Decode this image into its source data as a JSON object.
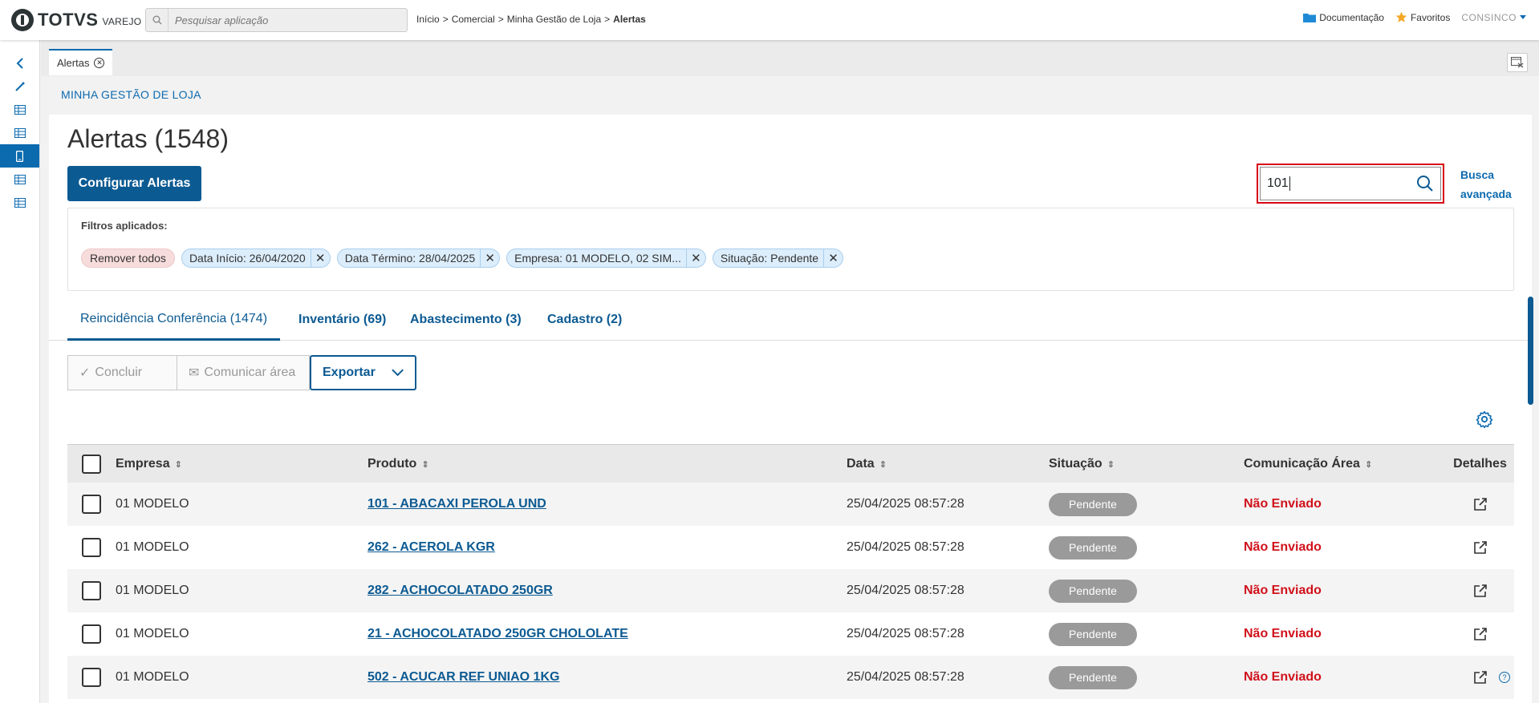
{
  "app": {
    "logo_text": "TOTVS",
    "logo_sub": "VAREJO",
    "search_placeholder": "Pesquisar aplicação",
    "breadcrumb": [
      "Início",
      "Comercial",
      "Minha Gestão de Loja",
      "Alertas"
    ],
    "breadcrumb_sep": ">",
    "documentation": "Documentação",
    "favorites": "Favoritos",
    "user": "CONSINCO"
  },
  "tab": {
    "label": "Alertas"
  },
  "section": {
    "title": "MINHA GESTÃO DE LOJA"
  },
  "page": {
    "title": "Alertas (1548)",
    "configure_button": "Configurar Alertas",
    "search_value": "101",
    "advanced_search_line1": "Busca",
    "advanced_search_line2": "avançada"
  },
  "filters": {
    "label": "Filtros aplicados:",
    "remove_all": "Remover todos",
    "chips": [
      "Data Início: 26/04/2020",
      "Data Término: 28/04/2025",
      "Empresa: 01 MODELO, 02 SIM...",
      "Situação: Pendente"
    ]
  },
  "detail_tabs": [
    "Reincidência Conferência (1474)",
    "Inventário (69)",
    "Abastecimento (3)",
    "Cadastro (2)"
  ],
  "actions": {
    "conclude": "Concluir",
    "communicate": "Comunicar área",
    "export": "Exportar"
  },
  "table": {
    "columns": [
      "Empresa",
      "Produto",
      "Data",
      "Situação",
      "Comunicação Área",
      "Detalhes"
    ],
    "rows": [
      {
        "empresa": "01 MODELO",
        "produto": "101 - ABACAXI PEROLA UND",
        "data": "25/04/2025 08:57:28",
        "situacao": "Pendente",
        "comunicacao": "Não Enviado"
      },
      {
        "empresa": "01 MODELO",
        "produto": "262 - ACEROLA KGR",
        "data": "25/04/2025 08:57:28",
        "situacao": "Pendente",
        "comunicacao": "Não Enviado"
      },
      {
        "empresa": "01 MODELO",
        "produto": "282 - ACHOCOLATADO 250GR",
        "data": "25/04/2025 08:57:28",
        "situacao": "Pendente",
        "comunicacao": "Não Enviado"
      },
      {
        "empresa": "01 MODELO",
        "produto": "21 - ACHOCOLATADO 250GR CHOLOLATE",
        "data": "25/04/2025 08:57:28",
        "situacao": "Pendente",
        "comunicacao": "Não Enviado"
      },
      {
        "empresa": "01 MODELO",
        "produto": "502 - ACUCAR REF UNIAO 1KG",
        "data": "25/04/2025 08:57:28",
        "situacao": "Pendente",
        "comunicacao": "Não Enviado"
      }
    ]
  },
  "colors": {
    "primary": "#0c5a92",
    "accent": "#0c6aaf",
    "danger": "#d0111b",
    "badge": "#9a9a9a"
  }
}
